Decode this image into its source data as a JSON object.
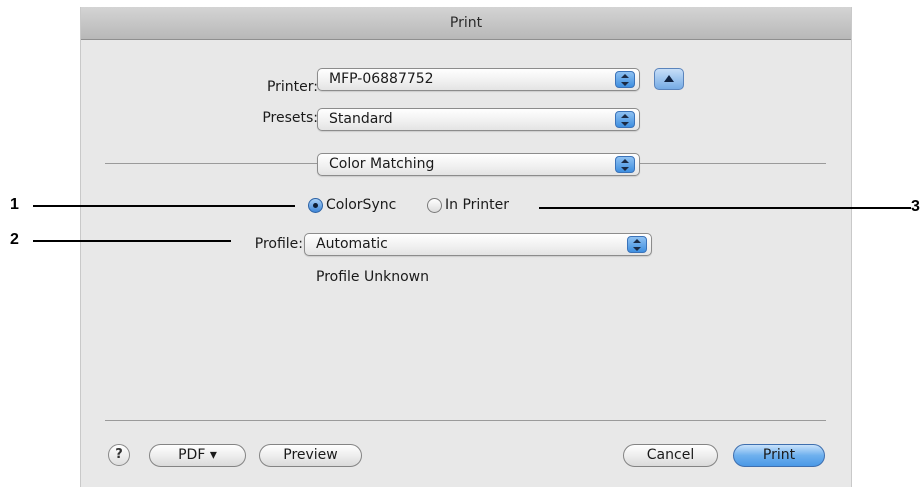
{
  "dialog": {
    "title": "Print"
  },
  "printer": {
    "label": "Printer:",
    "value": "MFP-06887752"
  },
  "presets": {
    "label": "Presets:",
    "value": "Standard"
  },
  "panel": {
    "value": "Color Matching"
  },
  "radios": {
    "colorsync_label": "ColorSync",
    "inprinter_label": "In Printer",
    "selected": "ColorSync"
  },
  "profile": {
    "label": "Profile:",
    "value": "Automatic",
    "status": "Profile Unknown"
  },
  "footer": {
    "help_label": "?",
    "pdf_label": "PDF ▾",
    "preview_label": "Preview",
    "cancel_label": "Cancel",
    "print_label": "Print"
  },
  "callouts": {
    "one": "1",
    "two": "2",
    "three": "3"
  }
}
